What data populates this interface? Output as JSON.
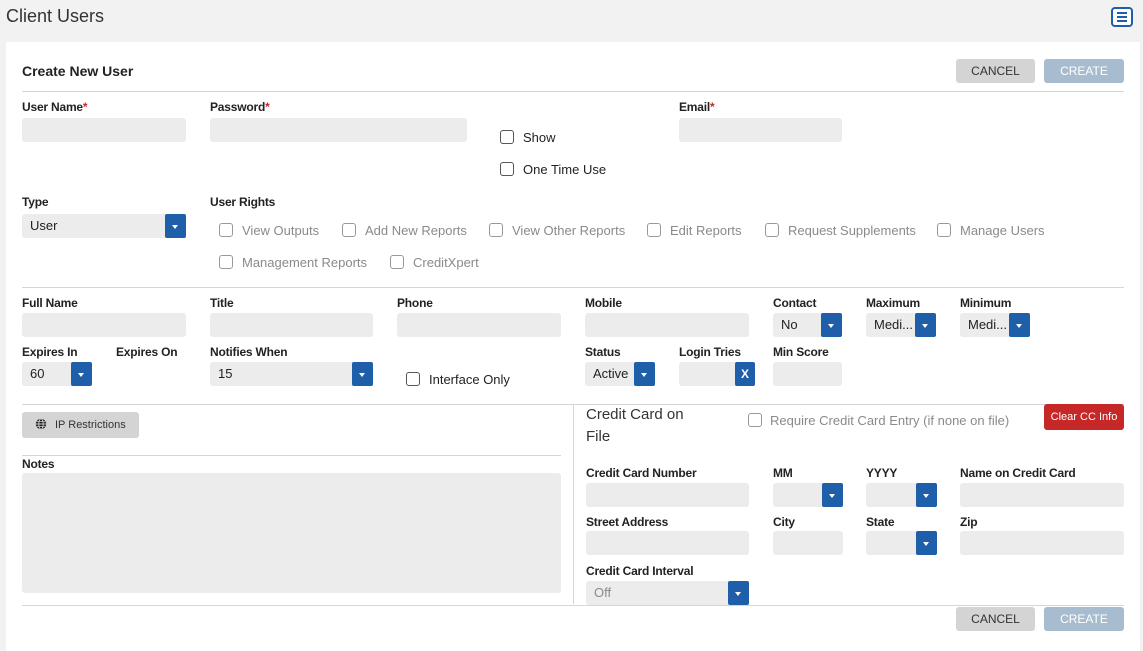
{
  "page": {
    "title": "Client Users",
    "menu_icon": "list-icon"
  },
  "form": {
    "heading": "Create New User",
    "cancel_label": "CANCEL",
    "create_label": "CREATE",
    "required_mark": "*",
    "accent_color": "#1f5ea8",
    "danger_color": "#c62828"
  },
  "fields": {
    "user_name": "User Name",
    "password": "Password",
    "email": "Email",
    "show": "Show",
    "one_time_use": "One Time Use",
    "type": "Type",
    "type_value": "User",
    "user_rights": "User Rights",
    "rights": [
      "View Outputs",
      "Add New Reports",
      "View Other Reports",
      "Edit Reports",
      "Request Supplements",
      "Manage Users",
      "Management Reports",
      "CreditXpert"
    ],
    "full_name": "Full Name",
    "title": "Title",
    "phone": "Phone",
    "mobile": "Mobile",
    "contact": "Contact",
    "contact_value": "No",
    "maximum": "Maximum",
    "maximum_value": "Medi...",
    "minimum": "Minimum",
    "minimum_value": "Medi...",
    "expires_in": "Expires In",
    "expires_in_value": "60",
    "expires_on": "Expires On",
    "notifies_when": "Notifies When",
    "notifies_when_value": "15",
    "interface_only": "Interface Only",
    "status": "Status",
    "status_value": "Active",
    "login_tries": "Login Tries",
    "login_tries_clear": "X",
    "min_score": "Min Score"
  },
  "left_panel": {
    "ip_restrictions": "IP Restrictions",
    "ip_icon": "globe-icon",
    "notes": "Notes"
  },
  "credit_card": {
    "heading_line1": "Credit Card on",
    "heading_line2": "File",
    "require_entry": "Require Credit Card Entry (if none on file)",
    "clear_button": "Clear CC Info",
    "number": "Credit Card Number",
    "mm": "MM",
    "yyyy": "YYYY",
    "name_on_card": "Name on Credit Card",
    "street": "Street Address",
    "city": "City",
    "state": "State",
    "zip": "Zip",
    "interval": "Credit Card Interval",
    "interval_value": "Off"
  }
}
